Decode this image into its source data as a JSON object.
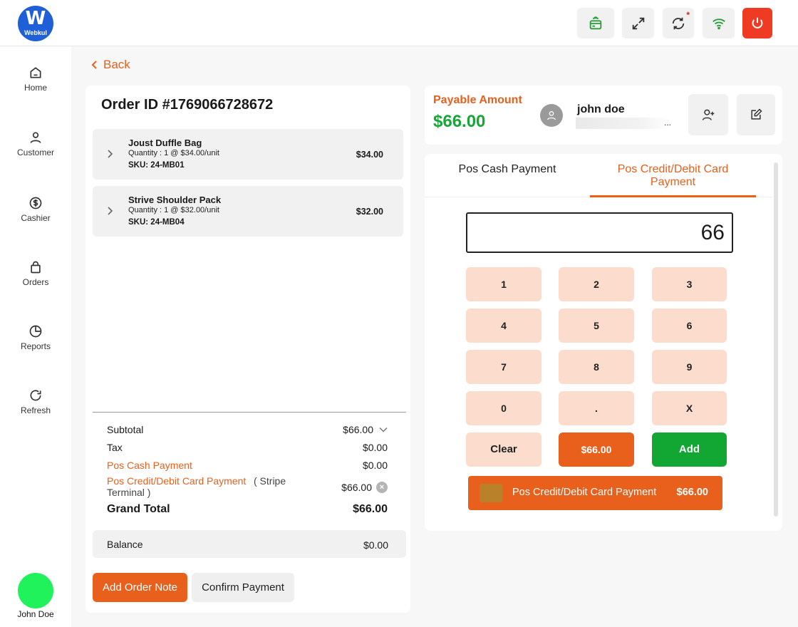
{
  "logo": {
    "letter": "W",
    "text": "Webkul"
  },
  "colors": {
    "accent": "#e8601c",
    "success": "#19a538",
    "danger": "#ef3b24",
    "keypad": "#fbdccd"
  },
  "topbar_icons": [
    "card-reader-icon",
    "expand-icon",
    "sync-icon",
    "wifi-icon",
    "power-icon"
  ],
  "sidebar": {
    "items": [
      {
        "label": "Home",
        "icon": "home-icon"
      },
      {
        "label": "Customer",
        "icon": "user-icon"
      },
      {
        "label": "Cashier",
        "icon": "dollar-icon"
      },
      {
        "label": "Orders",
        "icon": "bag-icon"
      },
      {
        "label": "Reports",
        "icon": "pie-chart-icon"
      },
      {
        "label": "Refresh",
        "icon": "refresh-icon"
      }
    ],
    "user_name": "John Doe"
  },
  "back_label": "Back",
  "order": {
    "title": "Order ID #1769066728672",
    "items": [
      {
        "name": "Joust Duffle Bag",
        "qty": "Quantity : 1 @ $34.00/unit",
        "sku": "SKU: 24-MB01",
        "price": "$34.00"
      },
      {
        "name": "Strive Shoulder Pack",
        "qty": "Quantity : 1 @ $32.00/unit",
        "sku": "SKU: 24-MB04",
        "price": "$32.00"
      }
    ],
    "summary": {
      "subtotal_label": "Subtotal",
      "subtotal": "$66.00",
      "tax_label": "Tax",
      "tax": "$0.00",
      "cash_label": "Pos Cash Payment",
      "cash": "$0.00",
      "card_label": "Pos Credit/Debit Card Payment",
      "card_note_1": "( Stripe",
      "card_note_2": "Terminal )",
      "card": "$66.00",
      "grand_label": "Grand Total",
      "grand": "$66.00"
    },
    "balance_label": "Balance",
    "balance": "$0.00",
    "add_note_label": "Add Order Note",
    "confirm_label": "Confirm Payment"
  },
  "payable": {
    "label": "Payable Amount",
    "amount": "$66.00",
    "customer_name": "john doe",
    "customer_email_tail": "..."
  },
  "payment": {
    "tab_cash": "Pos Cash Payment",
    "tab_card_1": "Pos Credit/Debit Card",
    "tab_card_2": "Payment",
    "display_value": "66",
    "keys": [
      "1",
      "2",
      "3",
      "4",
      "5",
      "6",
      "7",
      "8",
      "9",
      "0",
      ".",
      "X"
    ],
    "clear_label": "Clear",
    "quick_amount": "$66.00",
    "add_label": "Add",
    "applied_label": "Pos Credit/Debit Card Payment",
    "applied_amount": "$66.00"
  }
}
